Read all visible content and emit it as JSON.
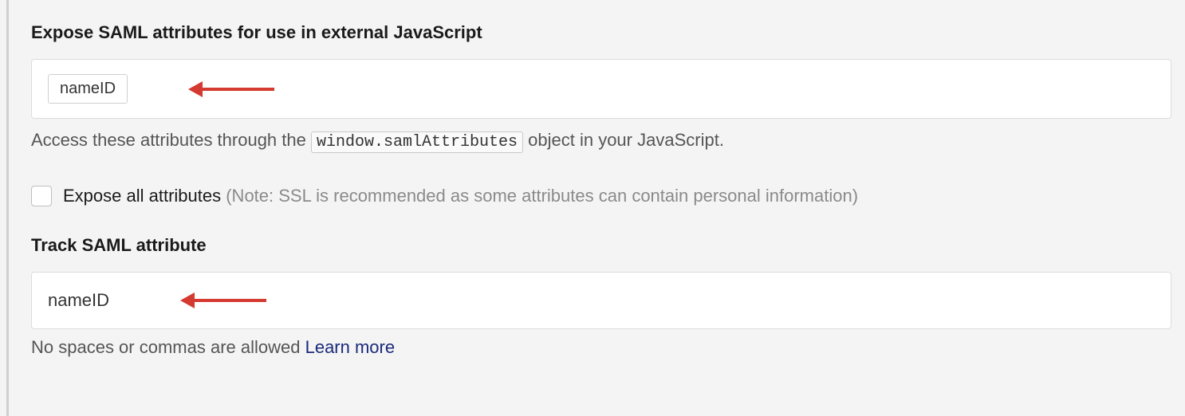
{
  "expose": {
    "heading": "Expose SAML attributes for use in external JavaScript",
    "token_value": "nameID",
    "helper_prefix": "Access these attributes through the ",
    "helper_code": "window.samlAttributes",
    "helper_suffix": " object in your JavaScript."
  },
  "expose_all": {
    "label": "Expose all attributes ",
    "note": "(Note: SSL is recommended as some attributes can contain personal information)"
  },
  "track": {
    "heading": "Track SAML attribute",
    "value": "nameID",
    "helper": "No spaces or commas are allowed ",
    "link": "Learn more"
  }
}
